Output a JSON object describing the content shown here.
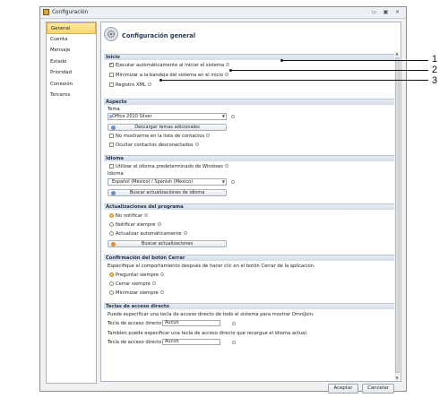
{
  "window": {
    "title": "Configuración"
  },
  "sidebar": {
    "items": [
      {
        "label": "General",
        "active": true
      },
      {
        "label": "Cuenta"
      },
      {
        "label": "Mensaje"
      },
      {
        "label": "Estado"
      },
      {
        "label": "Prioridad"
      },
      {
        "label": "Conexión"
      },
      {
        "label": "Terceros"
      }
    ]
  },
  "header": {
    "title": "Configuración general"
  },
  "sections": {
    "inicio": {
      "title": "Inicio",
      "items": [
        {
          "label": "Ejecutar automáticamente al iniciar el sistema",
          "checked": true
        },
        {
          "label": "Minimizar a la bandeja del sistema en el inicio",
          "checked": false
        },
        {
          "label": "Registro XML",
          "checked": false
        }
      ]
    },
    "aspecto": {
      "title": "Aspecto",
      "tema_label": "Tema",
      "tema_value": "Office 2010 Silver",
      "download_button": "Descargar temas adicionales",
      "items": [
        {
          "label": "No mostrarme en la lista de contactos",
          "checked": false
        },
        {
          "label": "Ocultar contactos desconectados",
          "checked": false
        }
      ]
    },
    "idioma": {
      "title": "Idioma",
      "use_default": "Utilizar el idioma predeterminado de Windows",
      "idioma_label": "Idioma",
      "idioma_value": "Español (México) / Spanish (Mexico)",
      "update_button": "Buscar actualizaciones de idioma"
    },
    "actualizaciones": {
      "title": "Actualizaciones del programa",
      "options": [
        {
          "label": "No notificar",
          "selected": true
        },
        {
          "label": "Notificar siempre",
          "selected": false
        },
        {
          "label": "Actualizar automáticamente",
          "selected": false
        }
      ],
      "search_button": "Buscar actualizaciones"
    },
    "cerrar": {
      "title": "Confirmación del botón Cerrar",
      "description": "Especifique el comportamiento después de hacer clic en el botón Cerrar de la aplicación.",
      "options": [
        {
          "label": "Preguntar siempre",
          "selected": true
        },
        {
          "label": "Cerrar siempre",
          "selected": false
        },
        {
          "label": "Minimizar siempre",
          "selected": false
        }
      ]
    },
    "teclas": {
      "title": "Teclas de acceso directo",
      "desc1": "Puede especificar una tecla de acceso directo de todo el sistema para mostrar OmniJoin.",
      "label1": "Tecla de acceso directo",
      "value1": "Aucun",
      "desc2": "También puede especificar una tecla de acceso directo que recargue el idioma actual.",
      "label2": "Tecla de acceso directo",
      "value2": "Aucun"
    }
  },
  "footer": {
    "accept": "Aceptar",
    "cancel": "Cancelar"
  },
  "callouts": [
    "1",
    "2",
    "3"
  ]
}
